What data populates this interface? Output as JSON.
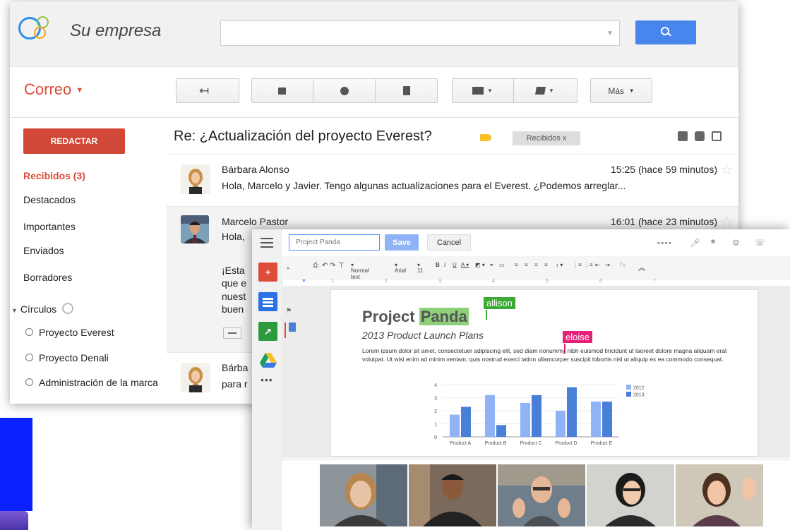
{
  "gmail": {
    "brand": "Su empresa",
    "app_label": "Correo",
    "toolbar": {
      "more_label": "Más"
    },
    "compose_label": "REDACTAR",
    "nav": [
      {
        "label": "Recibidos (3)"
      },
      {
        "label": "Destacados"
      },
      {
        "label": "Importantes"
      },
      {
        "label": "Enviados"
      },
      {
        "label": "Borradores"
      }
    ],
    "circles_label": "Círculos",
    "circles": [
      {
        "label": "Proyecto Everest"
      },
      {
        "label": "Proyecto Denali"
      },
      {
        "label": "Administración de la marca"
      }
    ],
    "thread": {
      "subject": "Re: ¿Actualización del proyecto Everest?",
      "label_chip": "Recibidos x",
      "messages": [
        {
          "sender": "Bárbara Alonso",
          "time": "15:25 (hace 59 minutos)",
          "snippet": "Hola, Marcelo y Javier. Tengo algunas actualizaciones para el Everest. ¿Podemos arreglar..."
        },
        {
          "sender": "Marcelo Pastor",
          "time": "16:01 (hace 23 minutos)",
          "snippet": "Hola,",
          "body": [
            "¡Esta",
            "que e",
            "nuest",
            "buen"
          ]
        },
        {
          "sender": "Bárba",
          "snippet": "para r"
        }
      ]
    }
  },
  "docs": {
    "doc_name_placeholder": "Project Panda",
    "save_label": "Save",
    "cancel_label": "Cancel",
    "format": {
      "style": "Normal text",
      "font": "Arial",
      "size": "11"
    },
    "ruler": [
      "1",
      "2",
      "3",
      "4",
      "5",
      "6",
      "7"
    ],
    "page": {
      "title_a": "Project",
      "title_b": "Panda",
      "subtitle": "2013 Product Launch Plans",
      "body": "Lorem ipsum dolor sit amet, consectetuer adipiscing elit, sed diam nonummy nibh euismod tincidunt ut laoreet dolore magna aliquam erat volutpat. Ut wisi enim ad minim veniam, quis nostrud exerci tation ullamcorper suscipit lobortis nisl ut aliquip ex ea commodo consequat.",
      "collaborators": [
        {
          "name": "allison",
          "color": "#3aaa35"
        },
        {
          "name": "eloise",
          "color": "#e8207a"
        }
      ]
    },
    "chart_data": {
      "type": "bar",
      "categories": [
        "Product A",
        "Product B",
        "Product C",
        "Product D",
        "Product E"
      ],
      "series": [
        {
          "name": "2012",
          "values": [
            1.7,
            3.2,
            2.6,
            2.0,
            2.7
          ],
          "color": "#8fb3f5"
        },
        {
          "name": "2013",
          "values": [
            2.3,
            0.9,
            3.2,
            3.8,
            2.7
          ],
          "color": "#4a7fd9"
        }
      ],
      "ylim": [
        0,
        4
      ],
      "yticks": [
        "0",
        "1",
        "2",
        "3",
        "4"
      ]
    }
  },
  "colors": {
    "gmail_red": "#dd4b39",
    "compose_red": "#d14836",
    "search_blue": "#4787ed"
  }
}
